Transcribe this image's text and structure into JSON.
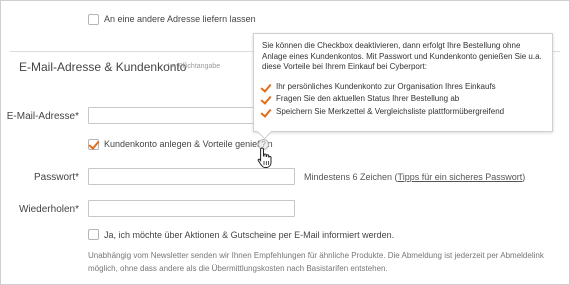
{
  "shipping": {
    "other_address_label": "An eine andere Adresse liefern lassen"
  },
  "section": {
    "title": "E-Mail-Adresse & Kundenkonto",
    "required_note": "* = Pflichtangabe"
  },
  "tooltip": {
    "intro": "Sie können die Checkbox deaktivieren, dann erfolgt Ihre Bestellung ohne Anlage eines Kundenkontos. Mit Passwort und Kundenkonto genießen Sie u.a. diese Vorteile bei Ihrem Einkauf bei Cyberport:",
    "items": [
      "Ihr persönliches Kundenkonto zur Organisation Ihres Einkaufs",
      "Fragen Sie den aktuellen Status Ihrer Bestellung ab",
      "Speichern Sie Merkzettel & Vergleichsliste plattformübergreifend"
    ]
  },
  "form": {
    "email_label": "E-Mail-Adresse*",
    "email_value": "",
    "account_checkbox_label": "Kundenkonto anlegen & Vorteile genießen",
    "account_checked": true,
    "help_icon_glyph": "?",
    "password_label": "Passwort*",
    "password_value": "",
    "password_hint_prefix": "Mindestens 6 Zeichen (",
    "password_hint_link": "Tipps für ein sicheres Passwort",
    "password_hint_suffix": ")",
    "repeat_label": "Wiederholen*",
    "repeat_value": "",
    "newsletter_label": "Ja, ich möchte über Aktionen & Gutscheine per E-Mail informiert werden.",
    "newsletter_checked": false,
    "newsletter_note": "Unabhängig vom Newsletter senden wir Ihnen Empfehlungen für ähnliche Produkte. Die Abmeldung ist jederzeit per Abmeldelink möglich, ohne dass andere als die Übermittlungskosten nach Basistarifen entstehen."
  },
  "colors": {
    "accent": "#e06d1a",
    "border": "#c7c7c7"
  },
  "icons": {
    "checkmark": "checkmark-icon",
    "help": "help-icon",
    "cursor": "hand-pointer-icon"
  }
}
